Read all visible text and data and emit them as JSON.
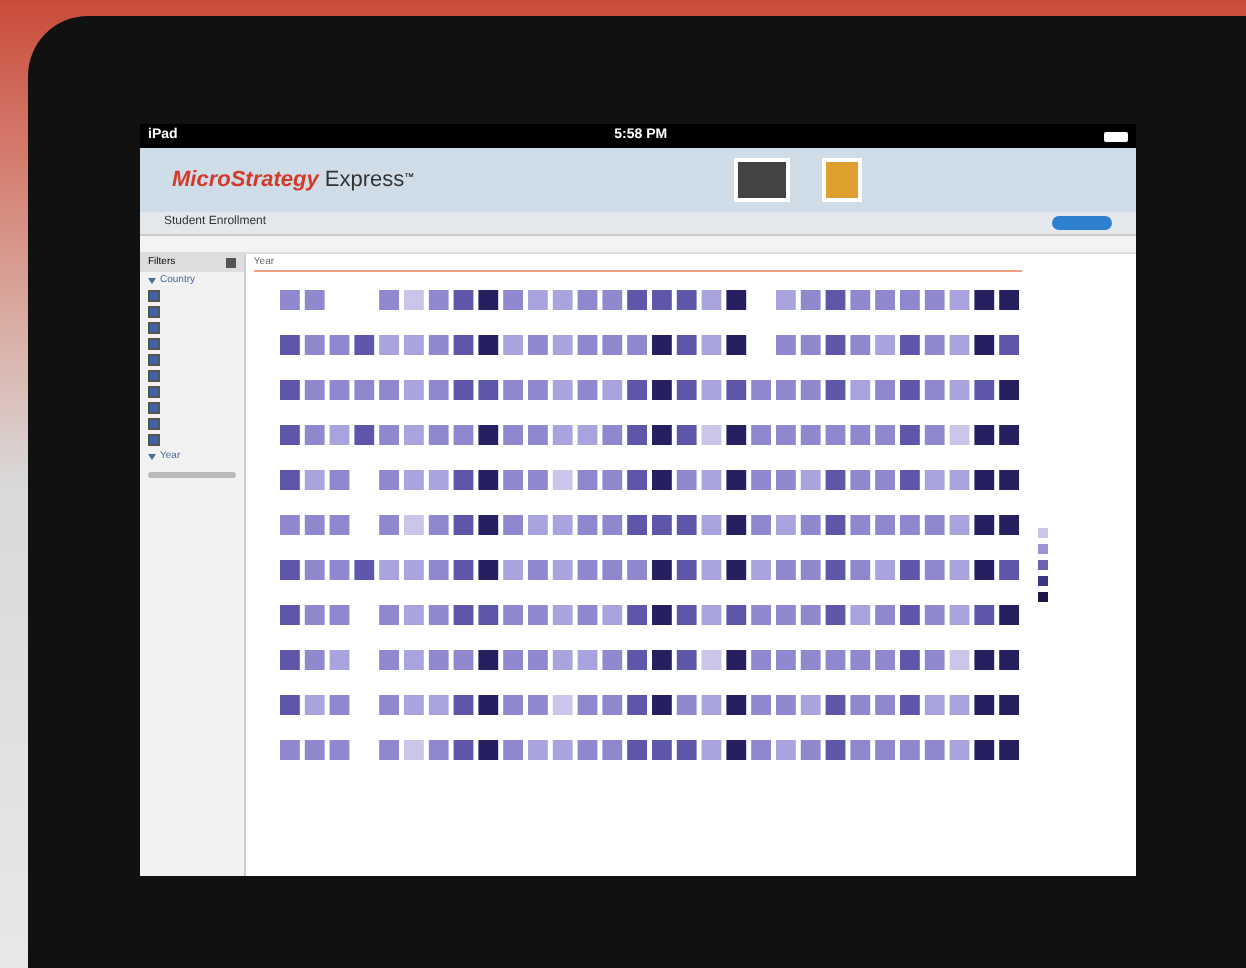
{
  "status_bar": {
    "carrier": "iPad",
    "time": "5:58 PM"
  },
  "header": {
    "logo_red": "MicroStrategy",
    "logo_dark": "Express",
    "trademark": "™"
  },
  "title_bar": {
    "title": "Student Enrollment"
  },
  "filters": {
    "title": "Filters",
    "groups": [
      {
        "label": "Country",
        "expanded": true,
        "items": [
          {
            "checked": true
          },
          {
            "checked": true
          },
          {
            "checked": true
          },
          {
            "checked": true
          },
          {
            "checked": true
          },
          {
            "checked": true
          },
          {
            "checked": true
          },
          {
            "checked": true
          },
          {
            "checked": true
          },
          {
            "checked": true
          }
        ]
      },
      {
        "label": "Year",
        "expanded": true
      }
    ]
  },
  "chart": {
    "axis_label": "Year"
  },
  "legend": {
    "swatches": [
      {
        "color": "#c9c6ea"
      },
      {
        "color": "#9b94d6"
      },
      {
        "color": "#6b62b4"
      },
      {
        "color": "#3b3585"
      },
      {
        "color": "#1b1847"
      }
    ]
  }
}
